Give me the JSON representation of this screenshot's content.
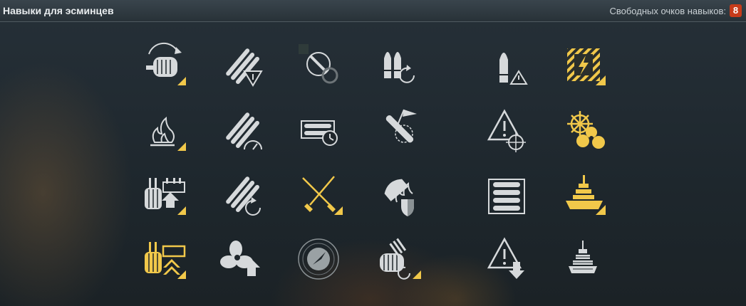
{
  "header": {
    "title": "Навыки для эсминцев",
    "points_label": "Свободных очков навыков:",
    "points_value": "8"
  },
  "skills": [
    {
      "icon": "gun-reload-icon",
      "state": "available",
      "tier": 1
    },
    {
      "icon": "torpedo-warning-icon",
      "state": "available",
      "tier": 1
    },
    {
      "icon": "prohibited-icon",
      "state": "locked",
      "tier": 1
    },
    {
      "icon": "shell-reload-icon",
      "state": "available",
      "tier": 1
    },
    {
      "icon": "shell-warning-icon",
      "state": "available",
      "tier": 1
    },
    {
      "icon": "electric-hazard-icon",
      "state": "learned",
      "tier": 1
    },
    {
      "icon": "fire-icon",
      "state": "available",
      "tier": 2
    },
    {
      "icon": "torpedo-speed-icon",
      "state": "available",
      "tier": 2
    },
    {
      "icon": "ammo-rack-timer-icon",
      "state": "available",
      "tier": 2
    },
    {
      "icon": "torpedo-flag-icon",
      "state": "available",
      "tier": 2
    },
    {
      "icon": "warning-crosshair-icon",
      "state": "available",
      "tier": 2
    },
    {
      "icon": "helm-propeller-icon",
      "state": "learned",
      "tier": 2
    },
    {
      "icon": "turret-upgrade-icon",
      "state": "available",
      "tier": 3
    },
    {
      "icon": "torpedo-reload-icon",
      "state": "available",
      "tier": 3
    },
    {
      "icon": "crossed-swords-icon",
      "state": "learned",
      "tier": 3
    },
    {
      "icon": "shell-fire-shield-icon",
      "state": "available",
      "tier": 3
    },
    {
      "icon": "ammo-rack-icon",
      "state": "available",
      "tier": 3
    },
    {
      "icon": "battleship-flag-icon",
      "state": "learned",
      "tier": 3
    },
    {
      "icon": "turret-double-upgrade-icon",
      "state": "learned",
      "tier": 4
    },
    {
      "icon": "propeller-upgrade-icon",
      "state": "available",
      "tier": 4
    },
    {
      "icon": "radar-icon",
      "state": "available",
      "tier": 4
    },
    {
      "icon": "turret-reload-icon",
      "state": "available",
      "tier": 4
    },
    {
      "icon": "warning-down-icon",
      "state": "available",
      "tier": 4
    },
    {
      "icon": "ship-silhouette-icon",
      "state": "available",
      "tier": 4
    }
  ],
  "colors": {
    "accent": "#f1c84a",
    "badge": "#c63b1a",
    "icon": "#d6d9db"
  }
}
